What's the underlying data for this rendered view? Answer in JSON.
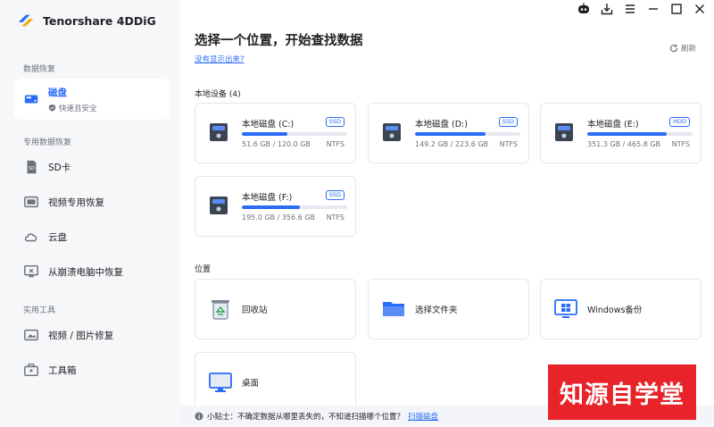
{
  "app": {
    "name": "Tenorshare 4DDiG"
  },
  "sidebar": {
    "sections": [
      {
        "label": "数据恢复"
      },
      {
        "label": "专用数据恢复"
      },
      {
        "label": "实用工具"
      }
    ],
    "active": {
      "label": "磁盘",
      "sub": "快速且安全"
    },
    "items": [
      {
        "label": "SD卡"
      },
      {
        "label": "视频专用恢复"
      },
      {
        "label": "云盘"
      },
      {
        "label": "从崩溃电脑中恢复"
      },
      {
        "label": "视频 / 图片修复"
      },
      {
        "label": "工具箱"
      }
    ]
  },
  "main": {
    "title": "选择一个位置，开始查找数据",
    "missing_link": "没有显示出来?",
    "refresh": "刷新",
    "drives_label": "本地设备 (4)",
    "drives": [
      {
        "name": "本地磁盘 (C:)",
        "type": "SSD",
        "size": "51.6 GB / 120.0 GB",
        "fs": "NTFS",
        "used_ratio": 0.43
      },
      {
        "name": "本地磁盘 (D:)",
        "type": "SSD",
        "size": "149.2 GB / 223.6 GB",
        "fs": "NTFS",
        "used_ratio": 0.67
      },
      {
        "name": "本地磁盘 (E:)",
        "type": "HDD",
        "size": "351.3 GB / 465.8 GB",
        "fs": "NTFS",
        "used_ratio": 0.75
      },
      {
        "name": "本地磁盘 (F:)",
        "type": "SSD",
        "size": "195.0 GB / 356.6 GB",
        "fs": "NTFS",
        "used_ratio": 0.55
      }
    ],
    "locations_label": "位置",
    "locations": [
      {
        "label": "回收站",
        "icon": "recycle-bin-icon"
      },
      {
        "label": "选择文件夹",
        "icon": "folder-icon"
      },
      {
        "label": "Windows备份",
        "icon": "windows-backup-icon"
      },
      {
        "label": "桌面",
        "icon": "desktop-icon"
      }
    ]
  },
  "tip": {
    "prefix": "小贴士：不确定数据从哪里丢失的，不知道扫描哪个位置？",
    "link": "扫描磁盘"
  },
  "watermark": "知源自学堂",
  "colors": {
    "accent": "#2a6cf6",
    "watermark_bg": "#e8242a"
  }
}
